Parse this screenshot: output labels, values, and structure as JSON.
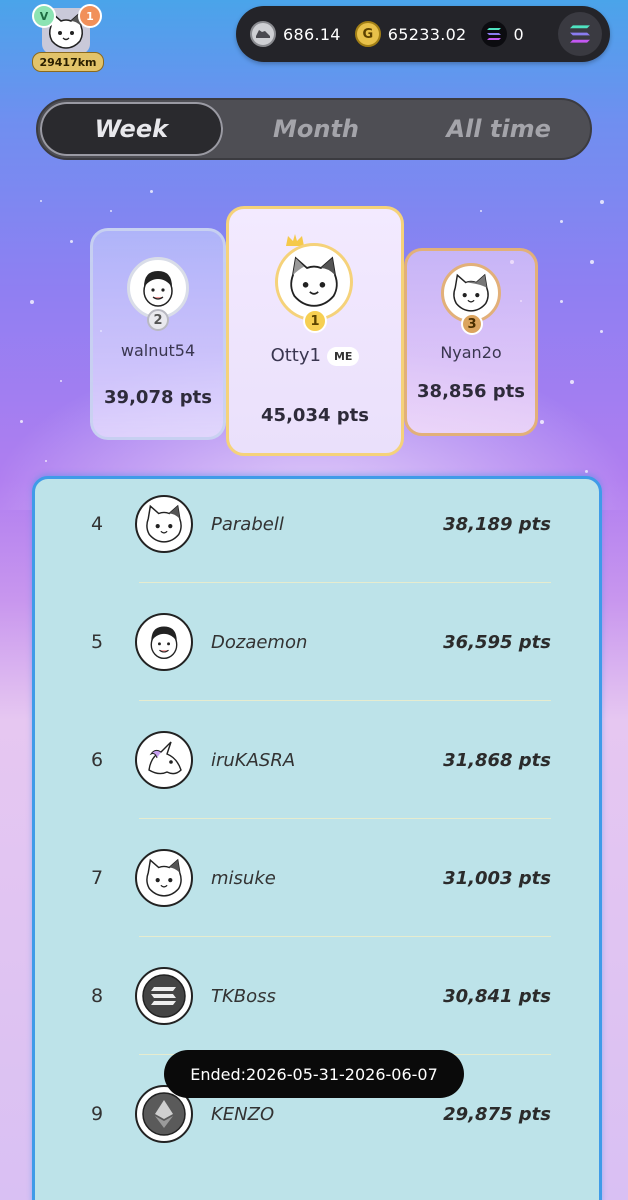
{
  "profile": {
    "v_label": "V",
    "level": "1",
    "distance": "29417km"
  },
  "currencies": [
    {
      "icon": "sneaker-token-icon",
      "value": "686.14"
    },
    {
      "icon": "gold-coin-icon",
      "value": "65233.02"
    },
    {
      "icon": "solana-icon",
      "value": "0"
    }
  ],
  "tabs": [
    {
      "label": "Week",
      "active": true
    },
    {
      "label": "Month",
      "active": false
    },
    {
      "label": "All time",
      "active": false
    }
  ],
  "podium": {
    "first": {
      "rank": "1",
      "name": "Otty1",
      "me_badge": "ME",
      "points": "45,034 pts"
    },
    "second": {
      "rank": "2",
      "name": "walnut54",
      "points": "39,078 pts"
    },
    "third": {
      "rank": "3",
      "name": "Nyan2o",
      "points": "38,856 pts"
    }
  },
  "leaderboard": [
    {
      "rank": "4",
      "name": "Parabell",
      "points": "38,189 pts",
      "avatar": "cat-avatar-icon"
    },
    {
      "rank": "5",
      "name": "Dozaemon",
      "points": "36,595 pts",
      "avatar": "boy-avatar-icon"
    },
    {
      "rank": "6",
      "name": "iruKASRA",
      "points": "31,868 pts",
      "avatar": "unicorn-avatar-icon"
    },
    {
      "rank": "7",
      "name": "misuke",
      "points": "31,003 pts",
      "avatar": "cat-avatar-icon"
    },
    {
      "rank": "8",
      "name": "TKBoss",
      "points": "30,841 pts",
      "avatar": "solana-avatar-icon"
    },
    {
      "rank": "9",
      "name": "KENZO",
      "points": "29,875 pts",
      "avatar": "ethereum-avatar-icon"
    }
  ],
  "tooltip": "Ended:2026-05-31-2026-06-07"
}
